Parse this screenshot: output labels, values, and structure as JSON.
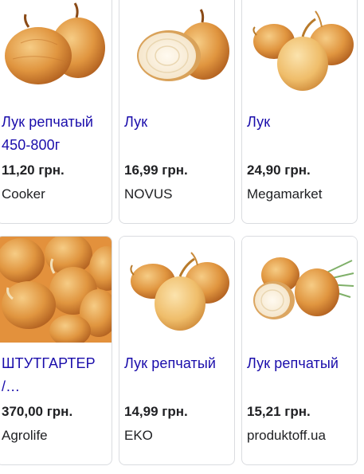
{
  "products": [
    {
      "title": "Лук репчатый 450-800г",
      "price": "11,20 грн.",
      "store": "Cooker",
      "image": "onion-pair-image"
    },
    {
      "title": "Лук",
      "price": "16,99 грн.",
      "store": "NOVUS",
      "image": "onion-halved-image"
    },
    {
      "title": "Лук",
      "price": "24,90 грн.",
      "store": "Megamarket",
      "image": "onion-trio-image"
    },
    {
      "title": "ШТУТГАРТЕР /…",
      "price": "370,00 грн.",
      "store": "Agrolife",
      "image": "onion-pile-image"
    },
    {
      "title": "Лук репчатый",
      "price": "14,99 грн.",
      "store": "EKO",
      "image": "onion-trio-image"
    },
    {
      "title": "Лук репчатый",
      "price": "15,21 грн.",
      "store": "produktoff.ua",
      "image": "onion-with-leaves-image"
    }
  ],
  "colors": {
    "title_link": "#1a0dab",
    "text": "#202124",
    "card_border": "#dadce0",
    "onion_light": "#f0b45e",
    "onion_dark": "#b0621c"
  }
}
